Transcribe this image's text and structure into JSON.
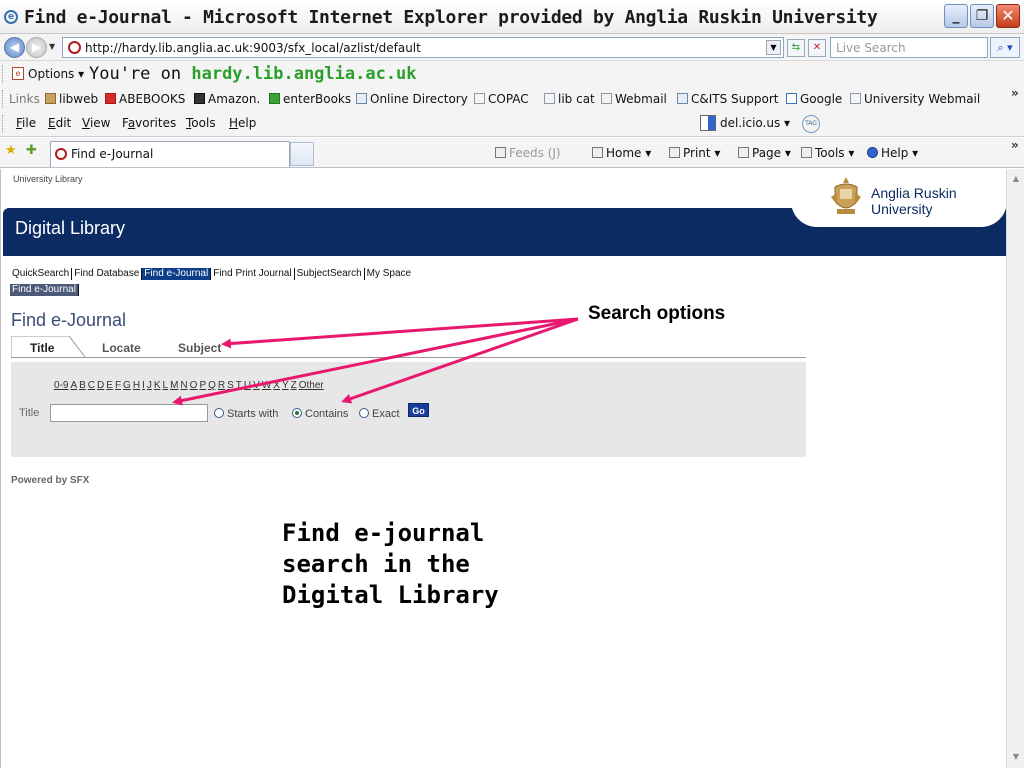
{
  "window": {
    "title": "Find e-Journal - Microsoft Internet Explorer provided by Anglia Ruskin University",
    "min_glyph": "_",
    "max_glyph": "❐",
    "close_glyph": "✕"
  },
  "address_bar": {
    "url": "http://hardy.lib.anglia.ac.uk:9003/sfx_local/azlist/default",
    "search_placeholder": "Live Search",
    "search_glyph": "⌕ ▾"
  },
  "toolbar": {
    "options_label": "Options ▾",
    "youre_on_prefix": "You're on ",
    "youre_on_host": "hardy.lib.anglia.ac.uk",
    "links_label": "Links",
    "links": [
      {
        "label": "libweb",
        "icon": "bank-icon"
      },
      {
        "label": "ABEBOOKS",
        "icon": "bird-icon"
      },
      {
        "label": "Amazon.",
        "icon": "amazon-icon"
      },
      {
        "label": "enterBooks",
        "icon": "eb-icon"
      },
      {
        "label": "Online Directory",
        "icon": "directory-icon"
      },
      {
        "label": "COPAC",
        "icon": "ie-page-icon"
      },
      {
        "label": "lib cat",
        "icon": "ie-page-icon"
      },
      {
        "label": "Webmail",
        "icon": "mail-icon"
      },
      {
        "label": "C&ITS Support",
        "icon": "support-icon"
      },
      {
        "label": "Google",
        "icon": "google-icon"
      },
      {
        "label": "University Webmail",
        "icon": "ie-page-icon"
      }
    ],
    "menus": [
      "File",
      "Edit",
      "View",
      "Favorites",
      "Tools",
      "Help"
    ],
    "menu_accel": [
      "F",
      "E",
      "V",
      "a",
      "T",
      "H"
    ],
    "delicious_label": "del.icio.us",
    "tag_label": "TAG"
  },
  "tabs": {
    "active_tab": "Find e-Journal",
    "feeds_label": "Feeds (J)",
    "home_label": "Home",
    "print_label": "Print",
    "page_label": "Page",
    "tools_label": "Tools",
    "help_label": "Help"
  },
  "page": {
    "university_library": "University Library",
    "digital_library": "Digital Library",
    "logo_line1": "Anglia Ruskin",
    "logo_line2": "University",
    "nav_links": [
      "QuickSearch",
      "Find Database",
      "Find e-Journal",
      "Find Print Journal",
      "SubjectSearch",
      "My Space"
    ],
    "nav_active_index": 2,
    "sub_nav_active": "Find e-Journal",
    "heading": "Find e-Journal",
    "search_tabs": [
      "Title",
      "Locate",
      "Subject"
    ],
    "alphabet": [
      "0-9",
      "A",
      "B",
      "C",
      "D",
      "E",
      "F",
      "G",
      "H",
      "I",
      "J",
      "K",
      "L",
      "M",
      "N",
      "O",
      "P",
      "Q",
      "R",
      "S",
      "T",
      "U",
      "V",
      "W",
      "X",
      "Y",
      "Z",
      "Other"
    ],
    "title_label": "Title",
    "title_value": "",
    "radio_options": [
      "Starts with",
      "Contains",
      "Exact"
    ],
    "radio_selected": "Contains",
    "go_label": "Go",
    "powered_by": "Powered by SFX"
  },
  "annotations": {
    "callout": "Search options",
    "caption_line1": "Find e-journal",
    "caption_line2": "search in the",
    "caption_line3": "Digital Library",
    "arrow_color": "#e8186e"
  }
}
